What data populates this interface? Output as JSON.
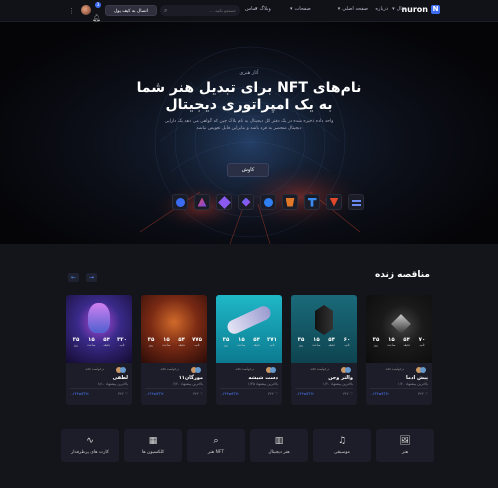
{
  "header": {
    "logo": "nuron",
    "nav": [
      "صفحه اصلی",
      "درباره",
      "مثال",
      "وبلاگ",
      "صفحات",
      "تماس"
    ],
    "search_placeholder": "جستجو بکنید ...",
    "wallet_button": "اتصال به کیف پول",
    "notification_count": "3"
  },
  "hero": {
    "subtitle": "آثار هنری",
    "title_line1": "نام‌های NFT برای تبدیل هنر شما",
    "title_line2": "به یک امپراتوری دیجیتال",
    "desc_line1": "واحد داده ذخیره شده در یک دفتر کل دیجیتال به نام بلاک چین که گواهی می دهد یک دارایی",
    "desc_line2": "دیجیتال منحصر به فرد باشد و بنابراین قابل تعویض نباشد",
    "cta": "کاوش",
    "coins": [
      "coin-a-icon",
      "coin-b-icon",
      "coin-c-icon",
      "coin-d-icon",
      "coin-e-icon",
      "coin-f-icon",
      "coin-g-icon",
      "coin-h-icon"
    ]
  },
  "auction": {
    "title": "مناقصه زنده",
    "bidders": "+۵۸ درخواست",
    "timer_units": [
      "روز",
      "ساعت",
      "دقیقه",
      "ثانیه"
    ],
    "cards": [
      {
        "name": "پیش ادما",
        "bid": "بالاترین پیشنهاد ۱/۲۰",
        "price": "۰.۲۴۴wETH",
        "likes": "۳۲۲",
        "timer": [
          "۳۵",
          "۱۵",
          "۵۴",
          "۷۰"
        ]
      },
      {
        "name": "والتر وجن",
        "bid": "بالاترین پیشنهاد ۱/۲۰",
        "price": "۰.۲۴۴wETH",
        "likes": "۳۲۲",
        "timer": [
          "۳۵",
          "۱۵",
          "۵۴",
          "۶۰"
        ]
      },
      {
        "name": "دست شیشه",
        "bid": "بالاترین پیشنهاد ۱/۳۵",
        "price": "۰.۲۴۴wETH",
        "likes": "۳۲۲",
        "timer": [
          "۳۵",
          "۱۵",
          "۵۴",
          "۲۷۱"
        ]
      },
      {
        "name": "مورگان۱۱",
        "bid": "بالاترین پیشنهاد ۶/۲۰",
        "price": "۰.۲۴۴wETH",
        "likes": "۳۲۲",
        "timer": [
          "۳۵",
          "۱۵",
          "۵۴",
          "۷۷۵"
        ]
      },
      {
        "name": "لطفی",
        "bid": "بالاترین پیشنهاد ۸/۱۰",
        "price": "۰.۲۴۴wETH",
        "likes": "۳۲۲",
        "timer": [
          "۳۵",
          "۱۵",
          "۵۴",
          "۳۲۰"
        ]
      }
    ]
  },
  "categories": [
    {
      "label": "هنر",
      "icon": "image-icon"
    },
    {
      "label": "موسیقی",
      "icon": "music-icon"
    },
    {
      "label": "هنر دیجیتال",
      "icon": "map-icon"
    },
    {
      "label": "هنر NFT",
      "icon": "search-icon"
    },
    {
      "label": "کلکسیون ها",
      "icon": "grid-icon"
    },
    {
      "label": "کارت های پرطرفدار",
      "icon": "pulse-icon"
    }
  ]
}
